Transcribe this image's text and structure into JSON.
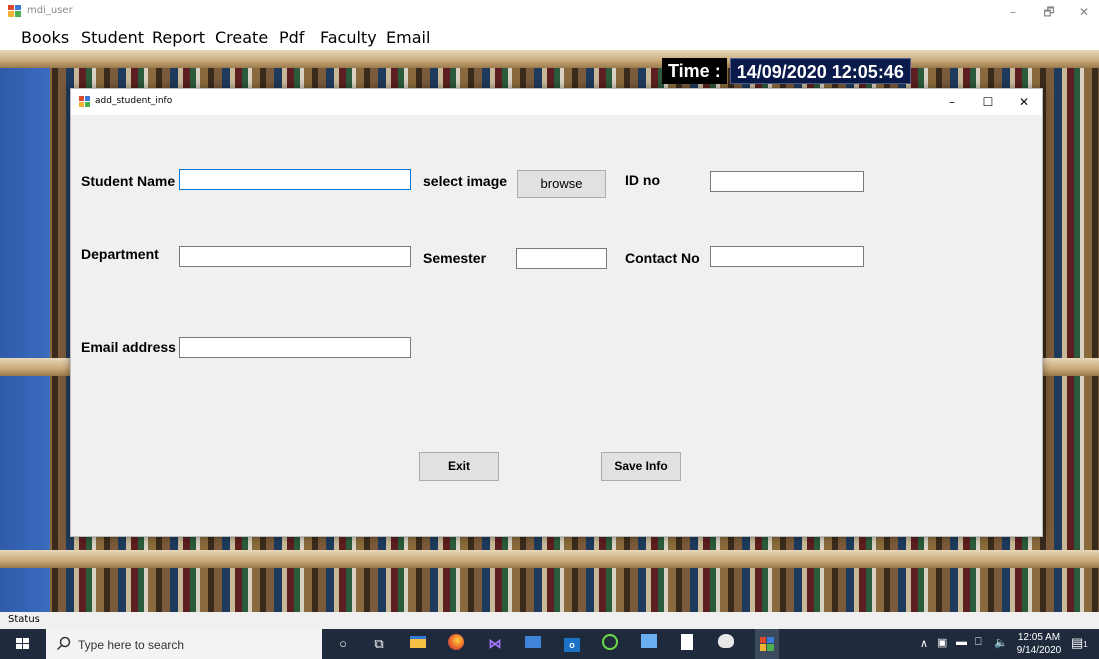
{
  "window": {
    "title": "mdi_user",
    "min": "–",
    "max": "🗗",
    "close": "✕"
  },
  "menu": [
    "Books",
    "Student",
    "Report",
    "Create",
    "Pdf",
    "Faculty",
    "Email"
  ],
  "time": {
    "label": "Time :",
    "value": "14/09/2020 12:05:46"
  },
  "form": {
    "title": "add_student_info",
    "min": "–",
    "max": "☐",
    "close": "✕",
    "labels": {
      "student_name": "Student Name",
      "select_image": "select image",
      "id_no": "ID no",
      "department": "Department",
      "semester": "Semester",
      "contact_no": "Contact No",
      "email": "Email address"
    },
    "fields": {
      "student_name": "",
      "id_no": "",
      "department": "",
      "semester": "",
      "contact_no": "",
      "email": ""
    },
    "buttons": {
      "browse": "browse",
      "exit": "Exit",
      "save": "Save Info"
    }
  },
  "status": {
    "text": "Status"
  },
  "taskbar": {
    "search_placeholder": "Type here to search",
    "time": "12:05 AM",
    "date": "9/14/2020",
    "notification_count": "1"
  }
}
